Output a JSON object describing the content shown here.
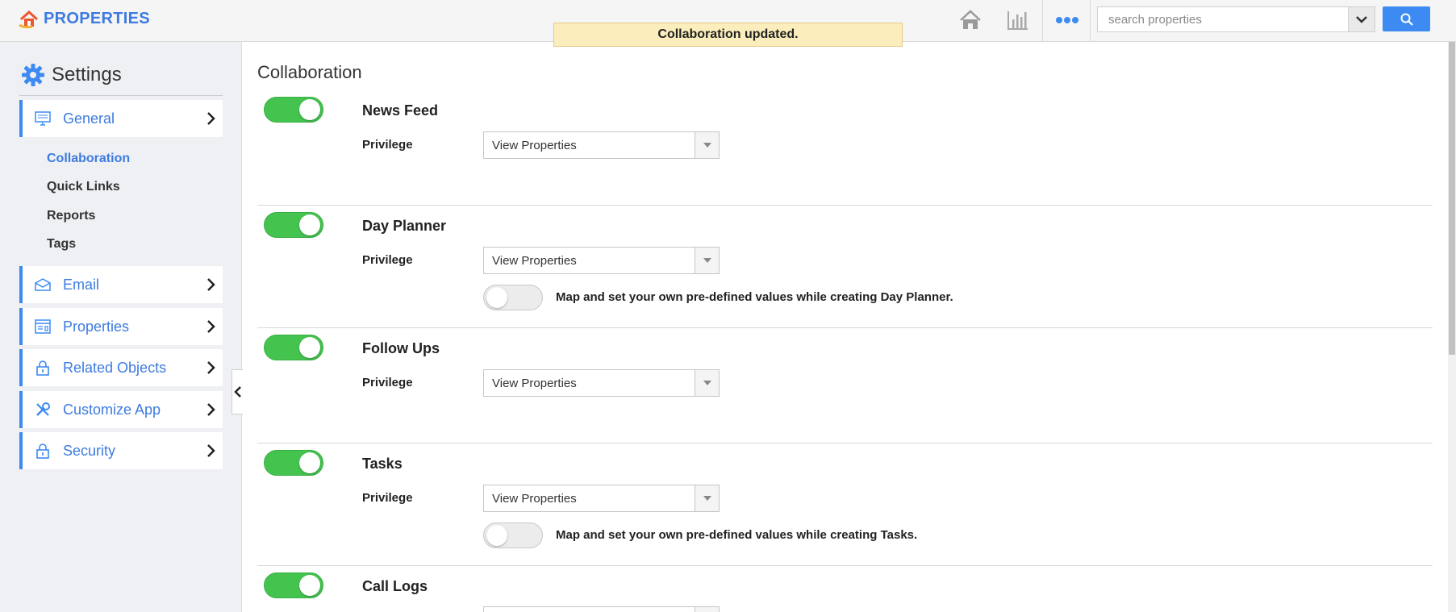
{
  "app": {
    "name": "PROPERTIES",
    "logo_icon": "house-logo-icon"
  },
  "toast": {
    "message": "Collaboration updated."
  },
  "top_nav": {
    "home_icon": "home-icon",
    "reports_icon": "bar-chart-icon",
    "more_icon": "more-dots-icon",
    "search": {
      "placeholder": "search properties",
      "value": ""
    },
    "search_button_icon": "search-icon"
  },
  "sidebar": {
    "title": "Settings",
    "items": [
      {
        "label": "General",
        "icon": "monitor-icon"
      },
      {
        "label": "Email",
        "icon": "envelope-icon"
      },
      {
        "label": "Properties",
        "icon": "window-icon"
      },
      {
        "label": "Related Objects",
        "icon": "lock-icon"
      },
      {
        "label": "Customize App",
        "icon": "tools-icon"
      },
      {
        "label": "Security",
        "icon": "lock-icon"
      }
    ],
    "sub_items": [
      {
        "label": "Collaboration",
        "active": true
      },
      {
        "label": "Quick Links",
        "active": false
      },
      {
        "label": "Reports",
        "active": false
      },
      {
        "label": "Tags",
        "active": false
      }
    ]
  },
  "main": {
    "title": "Collaboration",
    "sections": [
      {
        "name": "News Feed",
        "enabled": true,
        "privilege_label": "Privilege",
        "privilege_value": "View Properties"
      },
      {
        "name": "Day Planner",
        "enabled": true,
        "privilege_label": "Privilege",
        "privilege_value": "View Properties",
        "map_enabled": false,
        "map_text": "Map and set your own pre-defined values while creating Day Planner."
      },
      {
        "name": "Follow Ups",
        "enabled": true,
        "privilege_label": "Privilege",
        "privilege_value": "View Properties"
      },
      {
        "name": "Tasks",
        "enabled": true,
        "privilege_label": "Privilege",
        "privilege_value": "View Properties",
        "map_enabled": false,
        "map_text": "Map and set your own pre-defined values while creating Tasks."
      },
      {
        "name": "Call Logs",
        "enabled": true
      }
    ]
  },
  "colors": {
    "accent": "#3d7be0",
    "toggle_on": "#44c44f",
    "toast_bg": "#fbeebc"
  }
}
